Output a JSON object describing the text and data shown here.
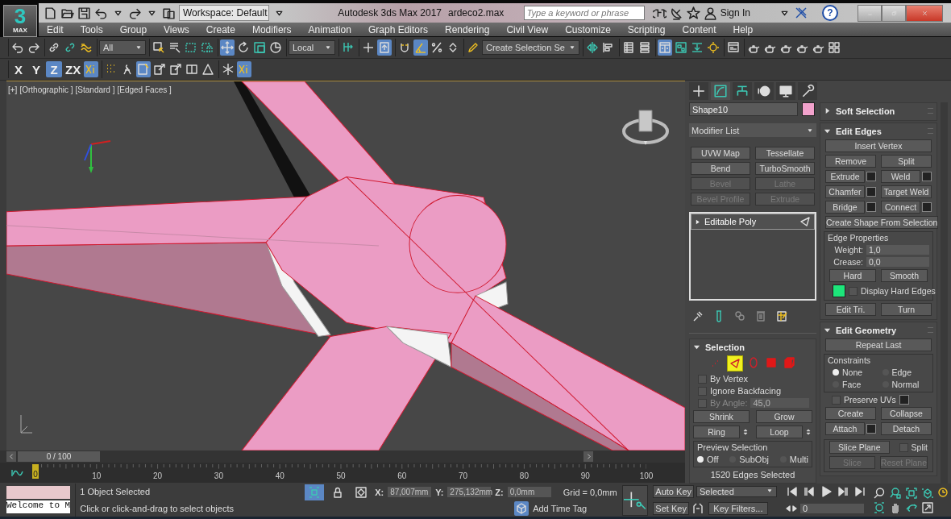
{
  "app": {
    "logo": "3",
    "logo_sub": "MAX",
    "workspace": "Workspace: Default",
    "title": "Autodesk 3ds Max 2017",
    "file": "ardeco2.max",
    "search_placeholder": "Type a keyword or phrase",
    "sign_in": "Sign In",
    "help": "?"
  },
  "menu": [
    "Edit",
    "Tools",
    "Group",
    "Views",
    "Create",
    "Modifiers",
    "Animation",
    "Graph Editors",
    "Rendering",
    "Civil View",
    "Customize",
    "Scripting",
    "Content",
    "Help"
  ],
  "main_toolbar": [
    [
      {
        "kind": "button",
        "selected": false
      },
      {
        "kind": "button",
        "selected": false
      }
    ],
    [
      {
        "kind": "button",
        "selected": false
      },
      {
        "kind": "button",
        "selected": false
      },
      {
        "kind": "button",
        "selected": false
      }
    ],
    [
      {
        "kind": "dropdown",
        "value": "All"
      }
    ],
    [
      {
        "kind": "button",
        "selected": false
      },
      {
        "kind": "button",
        "selected": false
      },
      {
        "kind": "button",
        "selected": false
      },
      {
        "kind": "button",
        "selected": false
      }
    ],
    [
      {
        "kind": "button",
        "selected": true
      },
      {
        "kind": "button",
        "selected": false
      },
      {
        "kind": "button",
        "selected": false
      },
      {
        "kind": "button",
        "selected": false
      }
    ],
    [
      {
        "kind": "dropdown",
        "value": "Local"
      }
    ],
    [
      {
        "kind": "button",
        "selected": false
      }
    ],
    [
      {
        "kind": "button",
        "selected": false
      },
      {
        "kind": "button",
        "selected": true
      }
    ],
    [
      {
        "kind": "button",
        "selected": false
      },
      {
        "kind": "button",
        "selected": true
      },
      {
        "kind": "button",
        "selected": false
      },
      {
        "kind": "button",
        "selected": false
      }
    ],
    [
      {
        "kind": "button",
        "selected": false
      },
      {
        "kind": "dropdown",
        "value": "Create Selection Se"
      }
    ],
    [
      {
        "kind": "button",
        "selected": false
      },
      {
        "kind": "button",
        "selected": false
      }
    ],
    [
      {
        "kind": "button",
        "selected": false
      },
      {
        "kind": "button",
        "selected": false
      }
    ],
    [
      {
        "kind": "button",
        "selected": true
      },
      {
        "kind": "button",
        "selected": false
      },
      {
        "kind": "button",
        "selected": false
      },
      {
        "kind": "button",
        "selected": false
      }
    ],
    [
      {
        "kind": "button",
        "selected": false
      }
    ],
    [
      {
        "kind": "button",
        "selected": false
      },
      {
        "kind": "button",
        "selected": false
      },
      {
        "kind": "button",
        "selected": false
      },
      {
        "kind": "button",
        "selected": false
      },
      {
        "kind": "button",
        "selected": false
      },
      {
        "kind": "button",
        "selected": false
      }
    ]
  ],
  "axis_toolbar": {
    "axes": [
      {
        "label": "X",
        "selected": false
      },
      {
        "label": "Y",
        "selected": false
      },
      {
        "label": "Z",
        "selected": true
      },
      {
        "label": "ZX",
        "selected": false
      }
    ],
    "tools": [
      [
        {
          "selected": true
        }
      ],
      [
        {
          "selected": false
        },
        {
          "selected": false
        },
        {
          "selected": true
        },
        {
          "selected": false
        },
        {
          "selected": false
        },
        {
          "selected": false
        },
        {
          "selected": false
        }
      ],
      [
        {
          "selected": false
        },
        {
          "selected": true
        }
      ]
    ]
  },
  "viewport": {
    "labels": [
      "[+]",
      "[Orthographic ]",
      "[Standard ]",
      "[Edged Faces ]"
    ]
  },
  "command_panel": {
    "tabs": [
      {
        "selected": false
      },
      {
        "selected": true
      },
      {
        "selected": false
      },
      {
        "selected": false
      },
      {
        "selected": false
      },
      {
        "selected": false
      }
    ],
    "object_name": "Shape10",
    "object_swatch": {
      "color": "#f2a2cc"
    },
    "modifier_list": "Modifier List",
    "modifier_buttons": [
      {
        "label": "UVW Map",
        "disabled": false
      },
      {
        "label": "Tessellate",
        "disabled": false
      },
      {
        "label": "Bend",
        "disabled": false
      },
      {
        "label": "TurboSmooth",
        "disabled": false
      },
      {
        "label": "Bevel",
        "disabled": true
      },
      {
        "label": "Lathe",
        "disabled": true
      },
      {
        "label": "Bevel Profile",
        "disabled": true
      },
      {
        "label": "Extrude",
        "disabled": true
      }
    ],
    "stack": [
      {
        "label": "Editable Poly",
        "selected": true
      }
    ],
    "stack_tools": [
      {
        "disabled": false
      },
      {
        "disabled": false
      },
      {
        "disabled": true
      },
      {
        "disabled": true
      },
      {
        "disabled": false
      }
    ],
    "selection": {
      "title": "Selection",
      "expanded": true,
      "levels": [
        {
          "selected": false
        },
        {
          "selected": true
        },
        {
          "selected": false
        },
        {
          "selected": false
        },
        {
          "selected": false
        }
      ],
      "checkboxes": [
        {
          "label": "By Vertex",
          "checked": false
        },
        {
          "label": "Ignore Backfacing",
          "checked": false
        }
      ],
      "by_angle": {
        "label": "By Angle:",
        "value": "45,0",
        "checked": false,
        "disabled": true
      },
      "buttons": [
        {
          "label": "Shrink",
          "spinner": false
        },
        {
          "label": "Grow",
          "spinner": false
        },
        {
          "label": "Ring",
          "spinner": true
        },
        {
          "label": "Loop",
          "spinner": true
        }
      ],
      "preview": {
        "title": "Preview Selection",
        "options": [
          {
            "label": "Off",
            "selected": true
          },
          {
            "label": "SubObj",
            "selected": false
          },
          {
            "label": "Multi",
            "selected": false
          }
        ]
      },
      "status": "1520 Edges Selected"
    },
    "soft_selection": {
      "title": "Soft Selection",
      "expanded": false
    },
    "edit_edges": {
      "title": "Edit Edges",
      "expanded": true,
      "rows": [
        [
          {
            "label": "Insert Vertex",
            "settings": false
          }
        ],
        [
          {
            "label": "Remove",
            "settings": false
          },
          {
            "label": "Split",
            "settings": false
          }
        ],
        [
          {
            "label": "Extrude",
            "settings": true
          },
          {
            "label": "Weld",
            "settings": true
          }
        ],
        [
          {
            "label": "Chamfer",
            "settings": true
          },
          {
            "label": "Target Weld",
            "settings": false
          }
        ],
        [
          {
            "label": "Bridge",
            "settings": true
          },
          {
            "label": "Connect",
            "settings": true
          }
        ],
        [
          {
            "label": "Create Shape From Selection",
            "settings": false
          }
        ]
      ],
      "edge_properties": {
        "title": "Edge Properties",
        "spinners": [
          {
            "label": "Weight:",
            "value": "1,0"
          },
          {
            "label": "Crease:",
            "value": "0,0"
          }
        ],
        "buttons": [
          "Hard",
          "Smooth"
        ],
        "hard_edge_swatch": {
          "color": "#1de57a"
        },
        "display_hard_edges": {
          "label": "Display Hard Edges",
          "checked": false
        }
      },
      "bottom": [
        "Edit Tri.",
        "Turn"
      ]
    },
    "edit_geometry": {
      "title": "Edit Geometry",
      "expanded": true,
      "repeat": "Repeat Last",
      "constraints": {
        "title": "Constraints",
        "options": [
          {
            "label": "None",
            "selected": true
          },
          {
            "label": "Edge",
            "selected": false
          },
          {
            "label": "Face",
            "selected": false
          },
          {
            "label": "Normal",
            "selected": false
          }
        ]
      },
      "preserve_uvs": {
        "label": "Preserve UVs",
        "checked": false
      },
      "rows": [
        [
          {
            "label": "Create",
            "settings": false
          },
          {
            "label": "Collapse",
            "settings": false
          }
        ],
        [
          {
            "label": "Attach",
            "settings": true
          },
          {
            "label": "Detach",
            "settings": false
          }
        ]
      ],
      "slice": {
        "plane": "Slice Plane",
        "split": {
          "label": "Split",
          "checked": false
        },
        "buttons": [
          {
            "label": "Slice",
            "disabled": true
          },
          {
            "label": "Reset Plane",
            "disabled": true
          }
        ]
      }
    }
  },
  "timeline": {
    "slider": "0 / 100",
    "level": 0,
    "current": "0",
    "ticks": [
      "10",
      "20",
      "30",
      "40",
      "50",
      "60",
      "70",
      "80",
      "90",
      "100"
    ]
  },
  "status": {
    "listener": "Welcome to M",
    "selection": "1 Object Selected",
    "prompt": "Click or click-and-drag to select objects",
    "toggles": [
      {
        "selected": true
      },
      {
        "selected": false
      },
      {
        "selected": false
      }
    ],
    "coords": [
      {
        "axis": "X:",
        "value": "87,007mm"
      },
      {
        "axis": "Y:",
        "value": "275,132mm"
      },
      {
        "axis": "Z:",
        "value": "0,0mm"
      }
    ],
    "grid": "Grid = 0,0mm",
    "time_tag": "Add Time Tag",
    "auto_key": {
      "label": "Auto Key",
      "on": false
    },
    "key_mode": "Selected",
    "set_key": "Set Key",
    "key_filters": "Key Filters...",
    "frame": "0"
  }
}
